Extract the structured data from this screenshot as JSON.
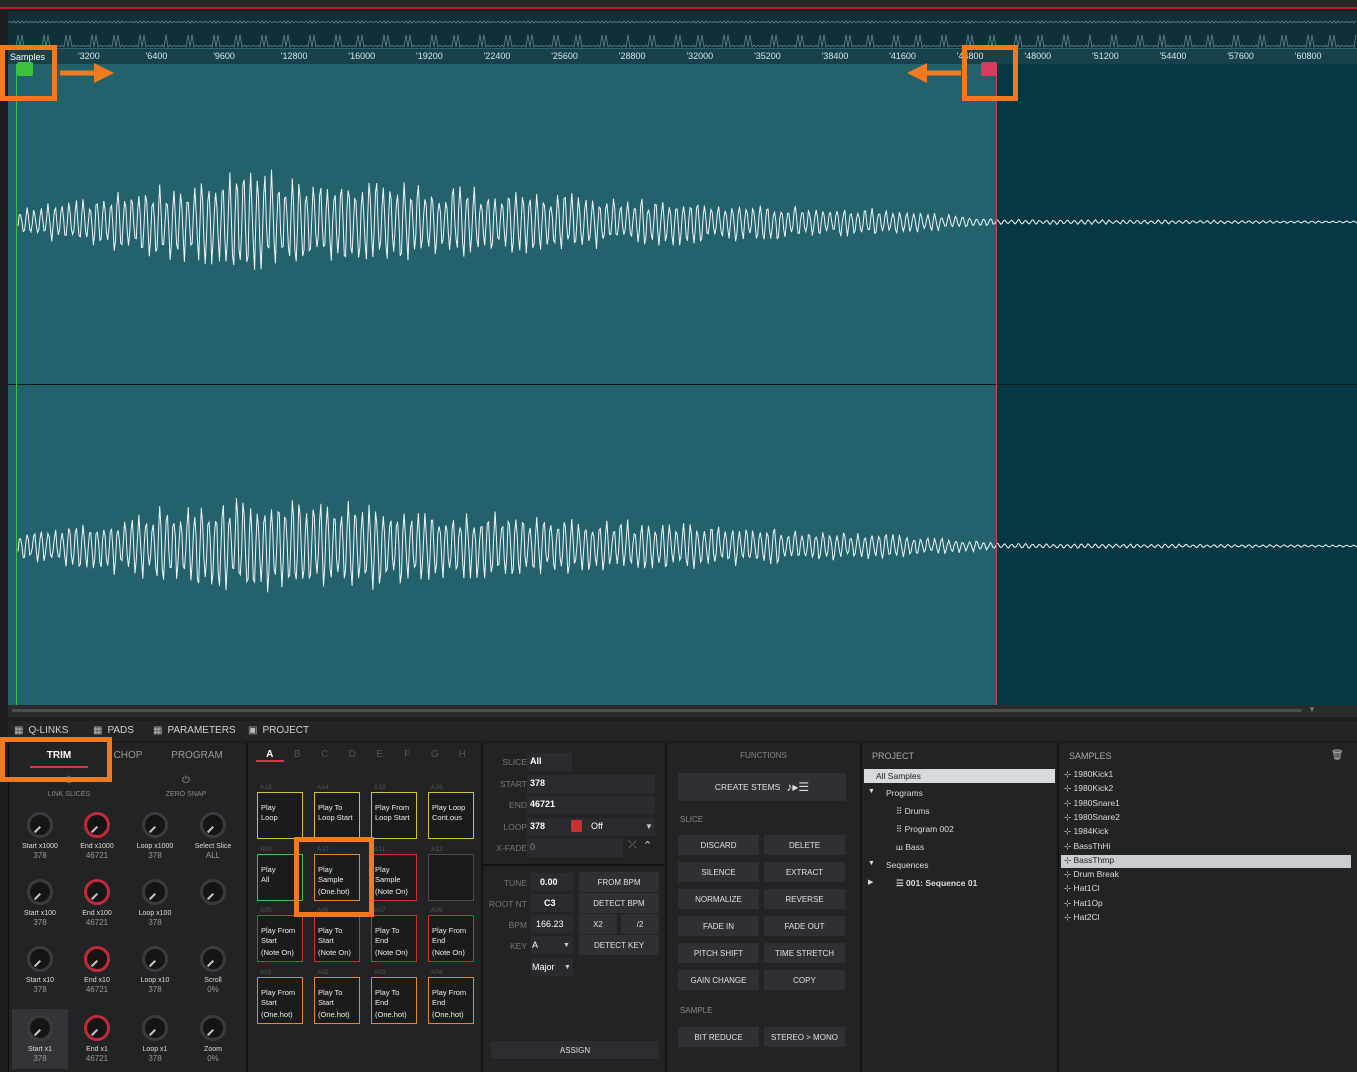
{
  "ruler": {
    "samples_label": "Samples",
    "ticks": [
      "'3200",
      "'6400",
      "'9600",
      "'12800",
      "'16000",
      "'19200",
      "'22400",
      "'25600",
      "'28800",
      "'32000",
      "'35200",
      "'38400",
      "'41600",
      "'44800",
      "'48000",
      "'51200",
      "'54400",
      "'57600",
      "'60800"
    ]
  },
  "colors": {
    "waveform_bg": "#23616c",
    "outside_region": "#053745",
    "start_marker": "#3ec23e",
    "end_marker": "#d83c5c",
    "highlight": "#f07a1f",
    "accent": "#d23c4a"
  },
  "tabs": {
    "qlinks": "Q-LINKS",
    "pads": "PADS",
    "parameters": "PARAMETERS",
    "project": "PROJECT"
  },
  "qlink_panel": {
    "modes": [
      "TRIM",
      "CHOP",
      "PROGRAM"
    ],
    "link_slices": "LINK SLICES",
    "zero_snap": "ZERO SNAP",
    "knobs": [
      {
        "label": "Start x1000",
        "value": "378"
      },
      {
        "label": "End x1000",
        "value": "46721"
      },
      {
        "label": "Loop x1000",
        "value": "378"
      },
      {
        "label": "Select Slice",
        "value": "ALL"
      },
      {
        "label": "Start x100",
        "value": "378"
      },
      {
        "label": "End x100",
        "value": "46721"
      },
      {
        "label": "Loop x100",
        "value": "378"
      },
      {
        "label": "",
        "value": ""
      },
      {
        "label": "Start x10",
        "value": "378"
      },
      {
        "label": "End x10",
        "value": "46721"
      },
      {
        "label": "Loop x10",
        "value": "378"
      },
      {
        "label": "Scroll",
        "value": "0%"
      },
      {
        "label": "Start x1",
        "value": "378"
      },
      {
        "label": "End x1",
        "value": "46721"
      },
      {
        "label": "Loop x1",
        "value": "378"
      },
      {
        "label": "Zoom",
        "value": "0%"
      }
    ]
  },
  "pad_panel": {
    "banks": [
      "A",
      "B",
      "C",
      "D",
      "E",
      "F",
      "G",
      "H"
    ],
    "pads": [
      {
        "id": "A13",
        "l1": "Play",
        "l2": "Loop",
        "sub": ""
      },
      {
        "id": "A14",
        "l1": "Play To",
        "l2": "Loop Start",
        "sub": ""
      },
      {
        "id": "A15",
        "l1": "Play From",
        "l2": "Loop Start",
        "sub": ""
      },
      {
        "id": "A16",
        "l1": "Play Loop",
        "l2": "Cont.ous",
        "sub": ""
      },
      {
        "id": "A09",
        "l1": "Play",
        "l2": "All",
        "sub": ""
      },
      {
        "id": "A10",
        "l1": "Play",
        "l2": "Sample",
        "sub": "(One.hot)"
      },
      {
        "id": "A11",
        "l1": "Play",
        "l2": "Sample",
        "sub": "(Note On)"
      },
      {
        "id": "A12",
        "l1": "",
        "l2": "",
        "sub": ""
      },
      {
        "id": "A05",
        "l1": "Play From",
        "l2": "Start",
        "sub": "(Note On)"
      },
      {
        "id": "A06",
        "l1": "Play To",
        "l2": "Start",
        "sub": "(Note On)"
      },
      {
        "id": "A07",
        "l1": "Play To",
        "l2": "End",
        "sub": "(Note On)"
      },
      {
        "id": "A08",
        "l1": "Play From",
        "l2": "End",
        "sub": "(Note On)"
      },
      {
        "id": "A01",
        "l1": "Play From",
        "l2": "Start",
        "sub": "(One.hot)"
      },
      {
        "id": "A02",
        "l1": "Play To",
        "l2": "Start",
        "sub": "(One.hot)"
      },
      {
        "id": "A03",
        "l1": "Play To",
        "l2": "End",
        "sub": "(One.hot)"
      },
      {
        "id": "A04",
        "l1": "Play From",
        "l2": "End",
        "sub": "(One.hot)"
      }
    ]
  },
  "params": {
    "slice_lbl": "SLICE",
    "slice_val": "All",
    "start_lbl": "START",
    "start_val": "378",
    "end_lbl": "END",
    "end_val": "46721",
    "loop_lbl": "LOOP",
    "loop_val": "378",
    "loop_mode": "Off",
    "xfade_lbl": "X-FADE",
    "xfade_val": "0",
    "tune_lbl": "TUNE",
    "tune_val": "0.00",
    "from_bpm": "FROM BPM",
    "root_lbl": "ROOT NT",
    "root_val": "C3",
    "detect_bpm": "DETECT BPM",
    "bpm_lbl": "BPM",
    "bpm_val": "166.23",
    "x2": "X2",
    "half": "/2",
    "key_lbl": "KEY",
    "key_val": "A",
    "detect_key": "DETECT KEY",
    "scale_val": "Major",
    "assign": "ASSIGN"
  },
  "functions": {
    "title": "FUNCTIONS",
    "create_stems": "CREATE STEMS",
    "slice_sec": "SLICE",
    "sample_sec": "SAMPLE",
    "buttons": [
      "DISCARD",
      "DELETE",
      "SILENCE",
      "EXTRACT",
      "NORMALIZE",
      "REVERSE",
      "FADE IN",
      "FADE OUT",
      "PITCH SHIFT",
      "TIME STRETCH",
      "GAIN CHANGE",
      "COPY"
    ],
    "sample_buttons": [
      "BIT REDUCE",
      "STEREO > MONO"
    ]
  },
  "project": {
    "title": "PROJECT",
    "all_samples": "All Samples",
    "programs": "Programs",
    "program_items": [
      "Drums",
      "Program 002",
      "Bass"
    ],
    "sequences": "Sequences",
    "sequence_items": [
      "001: Sequence 01"
    ]
  },
  "samples": {
    "title": "SAMPLES",
    "items": [
      "1980Kick1",
      "1980Kick2",
      "1980Snare1",
      "1980Snare2",
      "1984Kick",
      "BassThHi",
      "BassThmp",
      "Drum Break",
      "Hat1Cl",
      "Hat1Op",
      "Hat2Cl"
    ],
    "selected_index": 6
  }
}
